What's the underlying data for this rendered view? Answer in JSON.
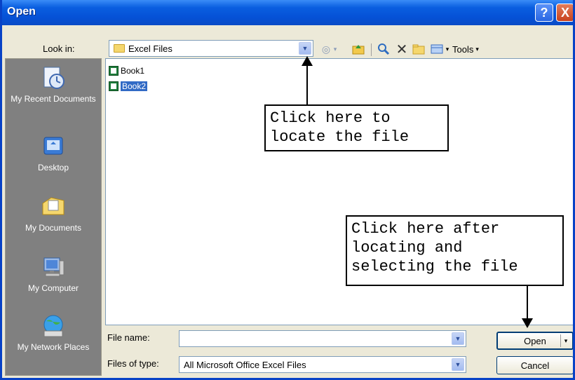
{
  "window": {
    "title": "Open",
    "help_glyph": "?",
    "close_glyph": "X"
  },
  "look_in": {
    "label": "Look in:",
    "value": "Excel Files",
    "folder_icon": "folder-icon"
  },
  "toolbar": {
    "tools_label": "Tools",
    "icons": [
      "back-icon",
      "up-folder-icon",
      "search-web-icon",
      "delete-icon",
      "new-folder-icon",
      "views-icon"
    ]
  },
  "places": [
    {
      "label": "My Recent Documents",
      "icon": "recent-documents-icon"
    },
    {
      "label": "Desktop",
      "icon": "desktop-icon"
    },
    {
      "label": "My Documents",
      "icon": "my-documents-icon"
    },
    {
      "label": "My Computer",
      "icon": "my-computer-icon"
    },
    {
      "label": "My Network Places",
      "icon": "network-places-icon"
    }
  ],
  "files": [
    {
      "name": "Book1",
      "selected": false
    },
    {
      "name": "Book2",
      "selected": true
    }
  ],
  "file_name": {
    "label": "File name:",
    "value": ""
  },
  "files_of_type": {
    "label": "Files of type:",
    "value": "All Microsoft Office Excel Files"
  },
  "buttons": {
    "open": "Open",
    "cancel": "Cancel"
  },
  "callouts": {
    "locate": "Click here to\nlocate the file",
    "open": "Click here after\nlocating and\nselecting the file"
  },
  "colors": {
    "titlebar": "#0a5ee0",
    "selection": "#316ac5",
    "places_bg": "#808080"
  }
}
